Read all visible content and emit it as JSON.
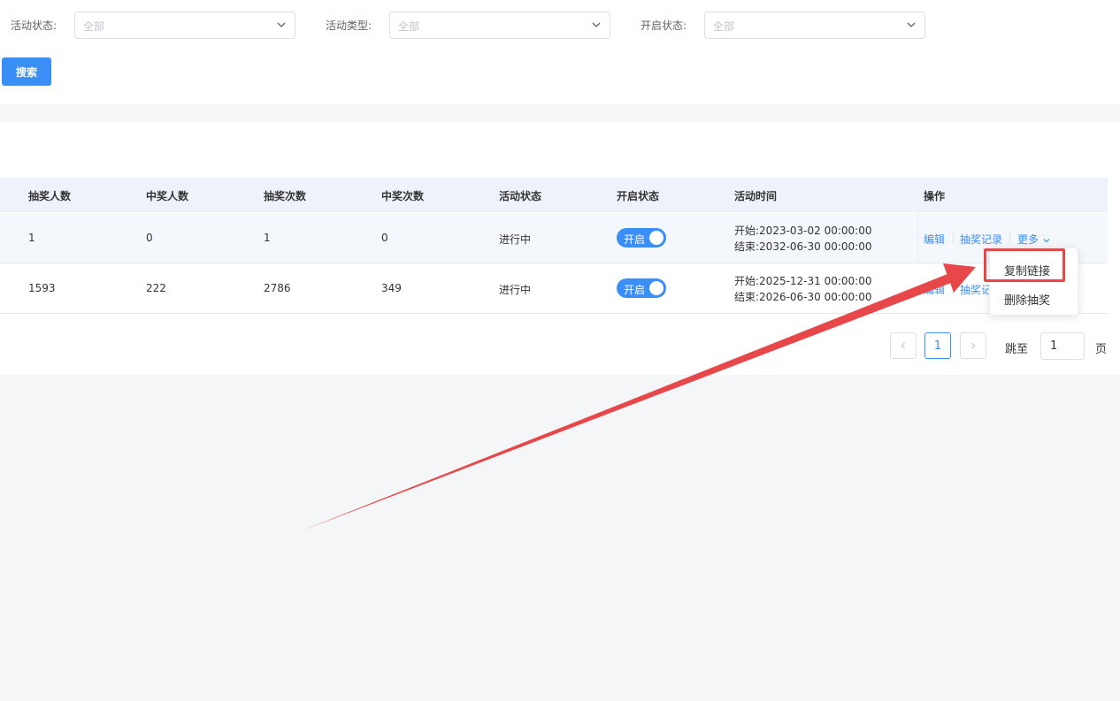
{
  "filters": {
    "status_label": "活动状态:",
    "status_value": "全部",
    "type_label": "活动类型:",
    "type_value": "全部",
    "open_label": "开启状态:",
    "open_value": "全部"
  },
  "search_label": "搜索",
  "table": {
    "headers": [
      "抽奖人数",
      "中奖人数",
      "抽奖次数",
      "中奖次数",
      "活动状态",
      "开启状态",
      "活动时间",
      "操作"
    ],
    "rows": [
      {
        "draw_people": "1",
        "win_people": "0",
        "draw_times": "1",
        "win_times": "0",
        "status": "进行中",
        "toggle": "开启",
        "start": "开始:2023-03-02 00:00:00",
        "end": "结束:2032-06-30 00:00:00"
      },
      {
        "draw_people": "1593",
        "win_people": "222",
        "draw_times": "2786",
        "win_times": "349",
        "status": "进行中",
        "toggle": "开启",
        "start": "开始:2025-12-31 00:00:00",
        "end": "结束:2026-06-30 00:00:00"
      }
    ],
    "actions": {
      "edit": "编辑",
      "records": "抽奖记录",
      "more": "更多"
    },
    "row1_records_clipped": "抽奖记"
  },
  "dropdown": {
    "copy_link": "复制链接",
    "delete": "删除抽奖"
  },
  "pagination": {
    "current_page": "1",
    "jump_label": "跳至",
    "jump_value": "1",
    "page_suffix": "页"
  },
  "colors": {
    "primary": "#3a8ef6",
    "annotation": "#e8474a"
  }
}
